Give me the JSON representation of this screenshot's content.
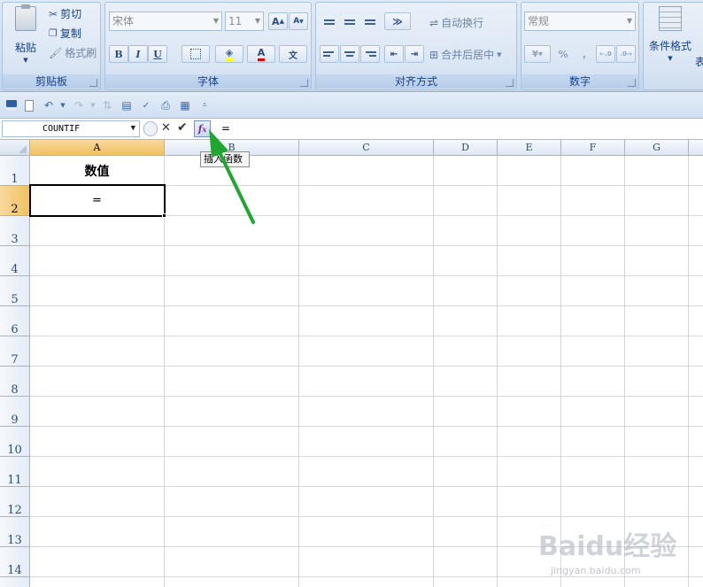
{
  "ribbon": {
    "clipboard": {
      "paste_label": "粘贴",
      "cut_label": "剪切",
      "copy_label": "复制",
      "format_painter_label": "格式刷",
      "group_label": "剪贴板"
    },
    "font": {
      "font_name": "宋体",
      "font_size": "11",
      "group_label": "字体"
    },
    "alignment": {
      "wrap_text_label": "自动换行",
      "merge_center_label": "合并后居中",
      "group_label": "对齐方式"
    },
    "number": {
      "format_value": "常规",
      "percent_label": "%",
      "comma_label": ",",
      "group_label": "数字"
    },
    "styles": {
      "conditional_format_label": "条件格式",
      "table_label_partial": "表"
    }
  },
  "formula_bar": {
    "name_box": "COUNTIF",
    "formula": "="
  },
  "tooltip": "插入函数",
  "columns": [
    "A",
    "B",
    "C",
    "D",
    "E",
    "F",
    "G"
  ],
  "rows": [
    "1",
    "2",
    "3",
    "4",
    "5",
    "6",
    "7",
    "8",
    "9",
    "10",
    "11",
    "12",
    "13",
    "14"
  ],
  "cells": {
    "A1": "数值",
    "A2": "="
  },
  "selected_cell": "A2",
  "watermark": {
    "brand": "Baidu经验",
    "url": "jingyan.baidu.com"
  },
  "colors": {
    "annotation_arrow": "#1fa82f",
    "selected_header": "#f1c15f"
  }
}
